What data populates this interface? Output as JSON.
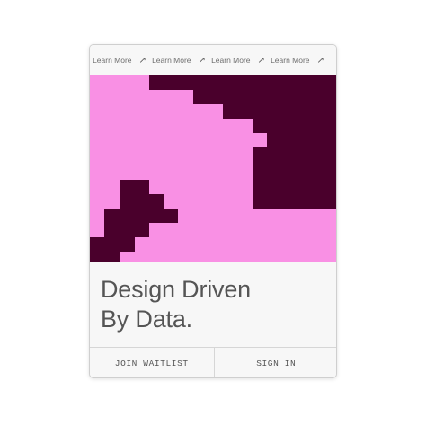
{
  "topbar": {
    "links": [
      {
        "label": "Learn More",
        "icon": "arrow-up-right-icon"
      },
      {
        "label": "Learn More",
        "icon": "arrow-up-right-icon"
      },
      {
        "label": "Learn More",
        "icon": "arrow-up-right-icon"
      },
      {
        "label": "Learn More",
        "icon": "arrow-up-right-icon"
      }
    ]
  },
  "hero": {
    "line1": "Design Driven",
    "line2": "By Data."
  },
  "footer": {
    "join_label": "JOIN WAITLIST",
    "signin_label": "SIGN IN"
  },
  "colors": {
    "pink": "#f990e4",
    "maroon": "#4a002c",
    "text": "#555555"
  }
}
